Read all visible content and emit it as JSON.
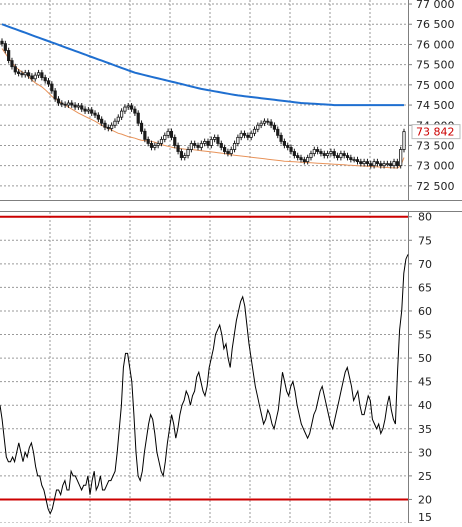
{
  "colors": {
    "background": "#ffffff",
    "grid": "#9a9a9a",
    "frame": "#7f7f7f",
    "ma_long": "#1f6fd0",
    "ma_short": "#e8935a",
    "candle": "#1a1a1a",
    "last_price_label": "#cc0000",
    "rsi_line": "#000000",
    "rsi_bounds": "#cc0000",
    "axis_text": "#222222"
  },
  "chart_data": [
    {
      "type": "candlestick",
      "panel": "price",
      "ylim": [
        72150,
        77100
      ],
      "y_ticks": [
        72500,
        73000,
        73500,
        74000,
        74500,
        75000,
        75500,
        76000,
        76500,
        77000
      ],
      "y_tick_labels": [
        "72 500",
        "73 000",
        "73 500",
        "74 000",
        "74 500",
        "75 000",
        "75 500",
        "76 000",
        "76 500",
        "77 000"
      ],
      "x_count": 138,
      "grid": true,
      "last_price_label": "73 842",
      "close": [
        76020,
        75850,
        75600,
        75450,
        75320,
        75280,
        75250,
        75300,
        75220,
        75150,
        75240,
        75300,
        75180,
        75100,
        75020,
        74850,
        74650,
        74550,
        74520,
        74500,
        74550,
        74500,
        74450,
        74480,
        74400,
        74350,
        74380,
        74300,
        74250,
        74150,
        74050,
        73950,
        73920,
        74000,
        74100,
        74200,
        74350,
        74450,
        74480,
        74400,
        74300,
        74050,
        73850,
        73650,
        73550,
        73450,
        73500,
        73550,
        73650,
        73750,
        73850,
        73700,
        73500,
        73350,
        73200,
        73250,
        73400,
        73550,
        73500,
        73450,
        73550,
        73600,
        73500,
        73650,
        73700,
        73550,
        73450,
        73350,
        73300,
        73400,
        73550,
        73700,
        73800,
        73750,
        73700,
        73800,
        73900,
        74000,
        74050,
        74100,
        74080,
        74000,
        73900,
        73750,
        73600,
        73500,
        73450,
        73350,
        73250,
        73200,
        73150,
        73100,
        73200,
        73300,
        73400,
        73350,
        73300,
        73250,
        73300,
        73350,
        73250,
        73200,
        73300,
        73250,
        73200,
        73150,
        73150,
        73100,
        73050,
        73100,
        73050,
        73000,
        73100,
        73050,
        73000,
        73050,
        73050,
        73000,
        73100,
        73000,
        73400,
        73842
      ],
      "ma_short": [
        75900,
        75780,
        75660,
        75550,
        75450,
        75380,
        75320,
        75270,
        75200,
        75120,
        75050,
        75000,
        74950,
        74880,
        74800,
        74720,
        74650,
        74600,
        74550,
        74500,
        74450,
        74400,
        74350,
        74300,
        74260,
        74220,
        74180,
        74140,
        74100,
        74050,
        74000,
        73960,
        73920,
        73880,
        73840,
        73800,
        73780,
        73750,
        73720,
        73700,
        73680,
        73650,
        73630,
        73620,
        73610,
        73600,
        73580,
        73550,
        73520,
        73500,
        73480,
        73460,
        73440,
        73430,
        73420,
        73410,
        73400,
        73400,
        73390,
        73380,
        73370,
        73360,
        73350,
        73340,
        73330,
        73320,
        73310,
        73300,
        73280,
        73270,
        73260,
        73250,
        73240,
        73230,
        73220,
        73210,
        73200,
        73190,
        73180,
        73170,
        73160,
        73150,
        73140,
        73130,
        73120,
        73110,
        73105,
        73100,
        73095,
        73090,
        73085,
        73080,
        73075,
        73070,
        73065,
        73060,
        73055,
        73050,
        73045,
        73040,
        73035,
        73030,
        73025,
        73020,
        73015,
        73010,
        73005,
        73000,
        72995,
        72990,
        72985,
        72980,
        72975,
        72970,
        72965,
        72960,
        72955,
        72950,
        72945,
        72940,
        73000,
        73200
      ],
      "ma_long": [
        76500,
        76470,
        76440,
        76410,
        76380,
        76350,
        76320,
        76290,
        76260,
        76230,
        76200,
        76170,
        76140,
        76110,
        76080,
        76050,
        76020,
        75990,
        75960,
        75930,
        75900,
        75870,
        75840,
        75810,
        75780,
        75750,
        75720,
        75690,
        75660,
        75630,
        75600,
        75570,
        75540,
        75510,
        75480,
        75450,
        75420,
        75390,
        75360,
        75330,
        75300,
        75280,
        75260,
        75240,
        75220,
        75200,
        75180,
        75160,
        75140,
        75120,
        75100,
        75080,
        75060,
        75040,
        75020,
        75000,
        74980,
        74960,
        74940,
        74920,
        74900,
        74885,
        74870,
        74855,
        74840,
        74825,
        74810,
        74795,
        74780,
        74765,
        74750,
        74740,
        74730,
        74720,
        74710,
        74700,
        74690,
        74680,
        74670,
        74660,
        74650,
        74640,
        74630,
        74620,
        74610,
        74600,
        74590,
        74580,
        74570,
        74560,
        74550,
        74545,
        74540,
        74535,
        74530,
        74525,
        74520,
        74515,
        74510,
        74505,
        74500,
        74500,
        74500,
        74500,
        74500,
        74500,
        74500,
        74500,
        74500,
        74500,
        74500,
        74500,
        74500,
        74500,
        74500,
        74500,
        74500,
        74500,
        74500,
        74500,
        74500,
        74500
      ]
    },
    {
      "type": "line",
      "panel": "oscillator",
      "ylim": [
        15,
        81
      ],
      "y_ticks": [
        15,
        20,
        25,
        30,
        35,
        40,
        45,
        50,
        55,
        60,
        65,
        70,
        75,
        80
      ],
      "y_tick_labels": [
        "15",
        "20",
        "25",
        "30",
        "35",
        "40",
        "45",
        "50",
        "55",
        "60",
        "65",
        "70",
        "75",
        "80"
      ],
      "reference_lines": [
        20,
        80
      ],
      "grid": true,
      "values": [
        40,
        37,
        33,
        29,
        28,
        28,
        29,
        28,
        30,
        32,
        30,
        28,
        30,
        29,
        31,
        32,
        30,
        27,
        25,
        25,
        23,
        22,
        20,
        18,
        17,
        18,
        20,
        22,
        22,
        21,
        23,
        24,
        22,
        22,
        26,
        25,
        25,
        24,
        23,
        22,
        23,
        23,
        25,
        21,
        24,
        26,
        22,
        23,
        25,
        22,
        22,
        23,
        24,
        24,
        25,
        26,
        30,
        35,
        40,
        48,
        51,
        51,
        48,
        45,
        38,
        30,
        25,
        24,
        26,
        30,
        33,
        36,
        38,
        37,
        34,
        30,
        28,
        26,
        25,
        28,
        32,
        35,
        38,
        36,
        33,
        35,
        38,
        40,
        41,
        43,
        42,
        40,
        42,
        43,
        46,
        47,
        45,
        43,
        42,
        44,
        48,
        50,
        52,
        55,
        56,
        57,
        55,
        52,
        53,
        50,
        48,
        52,
        55,
        58,
        60,
        62,
        63,
        61,
        57,
        53,
        50,
        47,
        44,
        42,
        40,
        38,
        36,
        37,
        39,
        38,
        36,
        35,
        37,
        39,
        43,
        47,
        45,
        43,
        42,
        44,
        45,
        43,
        40,
        38,
        36,
        35,
        34,
        33,
        34,
        36,
        38,
        39,
        41,
        43,
        44,
        42,
        40,
        38,
        36,
        35,
        37,
        39,
        41,
        43,
        45,
        47,
        48,
        46,
        44,
        41,
        42,
        43,
        40,
        38,
        38,
        40,
        42,
        41,
        37,
        36,
        35,
        36,
        34,
        35,
        37,
        40,
        42,
        39,
        37,
        36,
        47,
        56,
        60,
        68,
        71,
        72
      ]
    }
  ]
}
